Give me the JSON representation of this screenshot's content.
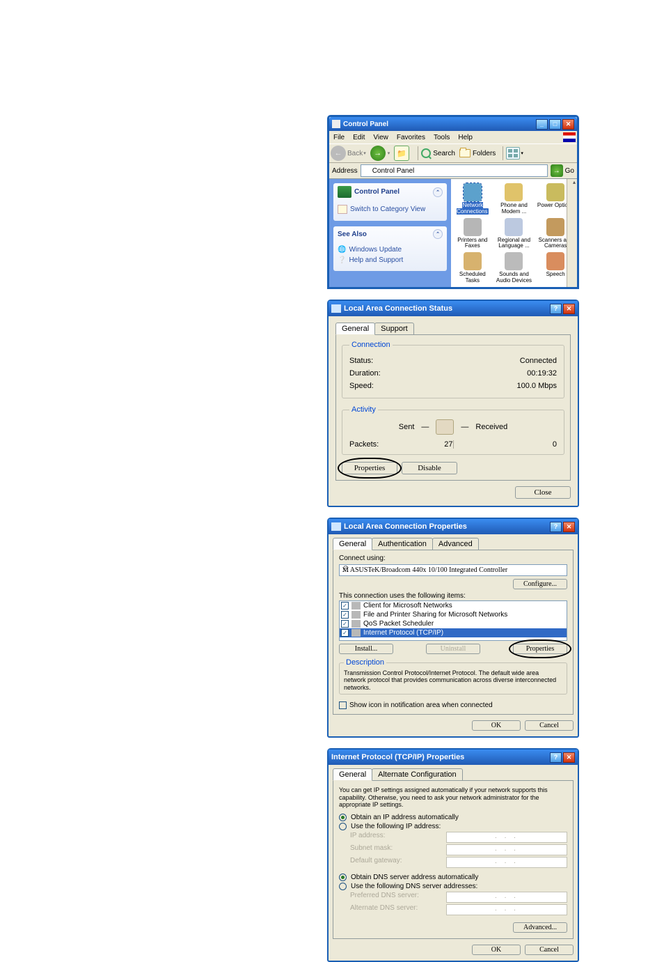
{
  "cp": {
    "title": "Control Panel",
    "menus": [
      "File",
      "Edit",
      "View",
      "Favorites",
      "Tools",
      "Help"
    ],
    "back": "Back",
    "search": "Search",
    "folders": "Folders",
    "addr_label": "Address",
    "addr_value": "Control Panel",
    "go": "Go",
    "task_panel": {
      "title": "Control Panel",
      "switch": "Switch to Category View"
    },
    "see_also": {
      "title": "See Also",
      "win_update": "Windows Update",
      "help": "Help and Support"
    },
    "icons": {
      "network": "Network Connections",
      "phone": "Phone and Modem ...",
      "power": "Power Options",
      "printers": "Printers and Faxes",
      "regional": "Regional and Language ...",
      "scanners": "Scanners and Cameras",
      "scheduled": "Scheduled Tasks",
      "sounds": "Sounds and Audio Devices",
      "speech": "Speech"
    }
  },
  "status": {
    "title": "Local Area Connection Status",
    "tabs": {
      "general": "General",
      "support": "Support"
    },
    "conn_legend": "Connection",
    "status_lbl": "Status:",
    "status_val": "Connected",
    "duration_lbl": "Duration:",
    "duration_val": "00:19:32",
    "speed_lbl": "Speed:",
    "speed_val": "100.0 Mbps",
    "activity_legend": "Activity",
    "sent": "Sent",
    "received": "Received",
    "packets_lbl": "Packets:",
    "packets_sent": "27",
    "packets_recv": "0",
    "properties_btn": "Properties",
    "disable_btn": "Disable",
    "close_btn": "Close"
  },
  "props": {
    "title": "Local Area Connection Properties",
    "tabs": {
      "general": "General",
      "auth": "Authentication",
      "adv": "Advanced"
    },
    "connect_using": "Connect using:",
    "adapter": "ASUSTeK/Broadcom 440x 10/100 Integrated Controller",
    "configure": "Configure...",
    "uses": "This connection uses the following items:",
    "items": {
      "client": "Client for Microsoft Networks",
      "fps": "File and Printer Sharing for Microsoft Networks",
      "qos": "QoS Packet Scheduler",
      "tcpip": "Internet Protocol (TCP/IP)"
    },
    "install": "Install...",
    "uninstall": "Uninstall",
    "properties": "Properties",
    "desc_legend": "Description",
    "desc_text": "Transmission Control Protocol/Internet Protocol. The default wide area network protocol that provides communication across diverse interconnected networks.",
    "show_icon": "Show icon in notification area when connected",
    "ok": "OK",
    "cancel": "Cancel"
  },
  "tcp": {
    "title": "Internet Protocol (TCP/IP) Properties",
    "tabs": {
      "general": "General",
      "alt": "Alternate Configuration"
    },
    "blurb": "You can get IP settings assigned automatically if your network supports this capability. Otherwise, you need to ask your network administrator for the appropriate IP settings.",
    "ip_auto": "Obtain an IP address automatically",
    "ip_manual": "Use the following IP address:",
    "ip_lbl": "IP address:",
    "mask_lbl": "Subnet mask:",
    "gw_lbl": "Default gateway:",
    "dns_auto": "Obtain DNS server address automatically",
    "dns_manual": "Use the following DNS server addresses:",
    "pref_dns": "Preferred DNS server:",
    "alt_dns": "Alternate DNS server:",
    "advanced": "Advanced...",
    "ok": "OK",
    "cancel": "Cancel"
  }
}
